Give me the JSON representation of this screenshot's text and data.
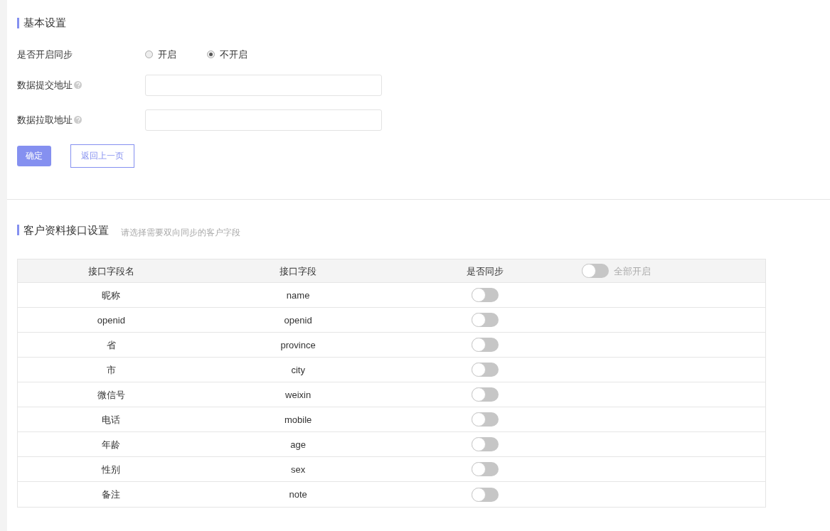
{
  "basic_settings": {
    "title": "基本设置",
    "sync_label": "是否开启同步",
    "sync_options": [
      {
        "label": "开启",
        "selected": false
      },
      {
        "label": "不开启",
        "selected": true
      }
    ],
    "fields": [
      {
        "label": "数据提交地址"
      },
      {
        "label": "数据拉取地址"
      }
    ],
    "confirm_button": "确定",
    "back_button": "返回上一页"
  },
  "customer_interface": {
    "title": "客户资料接口设置",
    "hint": "请选择需要双向同步的客户字段",
    "table": {
      "columns": [
        "接口字段名",
        "接口字段",
        "是否同步"
      ],
      "enable_all": {
        "label": "全部开启",
        "on": false
      },
      "rows": [
        {
          "name": "昵称",
          "field": "name",
          "on": false
        },
        {
          "name": "openid",
          "field": "openid",
          "on": false
        },
        {
          "name": "省",
          "field": "province",
          "on": false
        },
        {
          "name": "市",
          "field": "city",
          "on": false
        },
        {
          "name": "微信号",
          "field": "weixin",
          "on": false
        },
        {
          "name": "电话",
          "field": "mobile",
          "on": false
        },
        {
          "name": "年龄",
          "field": "age",
          "on": false
        },
        {
          "name": "性别",
          "field": "sex",
          "on": false
        },
        {
          "name": "备注",
          "field": "note",
          "on": false
        }
      ]
    }
  }
}
